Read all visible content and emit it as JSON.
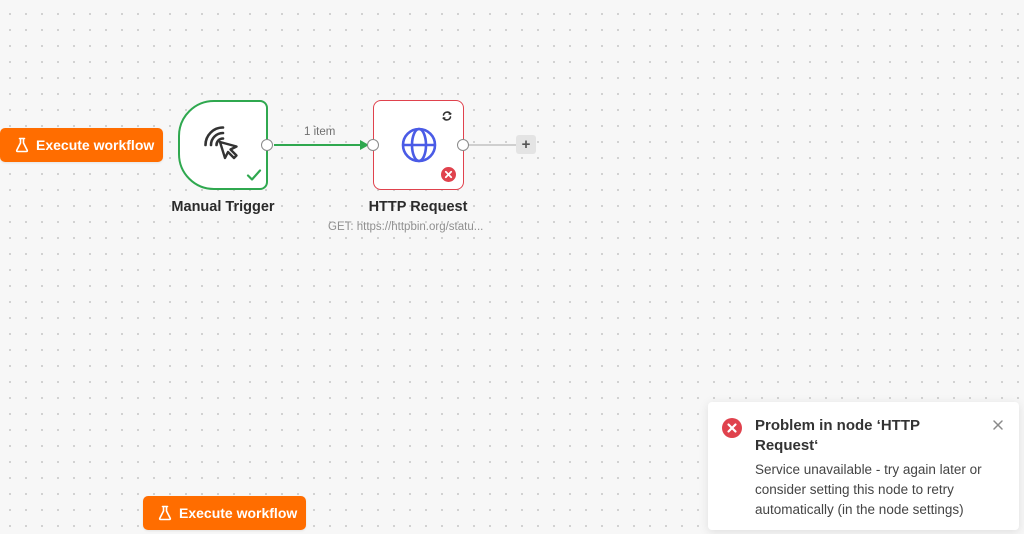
{
  "canvas": {
    "execute_button_label": "Execute workflow"
  },
  "nodes": {
    "trigger": {
      "label": "Manual Trigger",
      "icon": "pointer-click-icon",
      "status": "success"
    },
    "http": {
      "label": "HTTP Request",
      "subtitle": "GET: https://httpbin.org/statu...",
      "icon": "globe-icon",
      "status": "error"
    }
  },
  "connection": {
    "label": "1 item"
  },
  "add_node": {
    "label": "+"
  },
  "toast": {
    "title": "Problem in node ‘HTTP Request‘",
    "message": "Service unavailable - try again later or consider setting this node to retry automatically (in the node settings)"
  },
  "colors": {
    "accent": "#ff6d00",
    "success": "#2fa84f",
    "error": "#e0424d",
    "globe": "#4a5be6"
  }
}
